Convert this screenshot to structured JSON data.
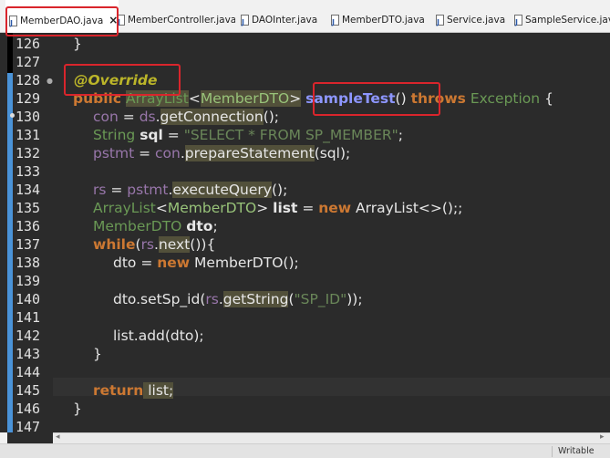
{
  "tabs": [
    {
      "label": "MemberDAO.java",
      "close": "×"
    },
    {
      "label": "MemberController.java"
    },
    {
      "label": "DAOInter.java"
    },
    {
      "label": "MemberDTO.java"
    },
    {
      "label": "Service.java"
    },
    {
      "label": "SampleService.java"
    }
  ],
  "lines": {
    "n126": "126",
    "n127": "127",
    "n128": "128",
    "n129": "129",
    "n130": "130",
    "n131": "131",
    "n132": "132",
    "n133": "133",
    "n134": "134",
    "n135": "135",
    "n136": "136",
    "n137": "137",
    "n138": "138",
    "n139": "139",
    "n140": "140",
    "n141": "141",
    "n142": "142",
    "n143": "143",
    "n144": "144",
    "n145": "145",
    "n146": "146",
    "n147": "147"
  },
  "code": {
    "l126": "}",
    "l128_ann": "@Override",
    "l129_public": "public",
    "l129_type": "ArrayList",
    "l129_lt": "<",
    "l129_gen": "MemberDTO",
    "l129_gt": ">",
    "l129_name": "sampleTest",
    "l129_paren": "()",
    "l129_throws": "throws",
    "l129_exc": "Exception",
    "l129_brace": "{",
    "l130_var": "con",
    "l130_eq": " = ",
    "l130_ds": "ds",
    "l130_dot": ".",
    "l130_call": "getConnection",
    "l130_end": "();",
    "l131_type": "String",
    "l131_name": "sql",
    "l131_eq": " = ",
    "l131_str": "\"SELECT * FROM SP_MEMBER\"",
    "l131_end": ";",
    "l132_var": "pstmt",
    "l132_eq": " = ",
    "l132_con": "con",
    "l132_dot": ".",
    "l132_call": "prepareStatement",
    "l132_end": "(sql);",
    "l134_var": "rs",
    "l134_eq": " = ",
    "l134_pstmt": "pstmt",
    "l134_dot": ".",
    "l134_call": "executeQuery",
    "l134_end": "();",
    "l135_type": "ArrayList",
    "l135_lt": "<",
    "l135_gen": "MemberDTO",
    "l135_gt": ">",
    "l135_name": "list",
    "l135_eq": " = ",
    "l135_new": "new",
    "l135_rest": " ArrayList<>();;",
    "l136_type": "MemberDTO",
    "l136_name": "dto",
    "l136_end": ";",
    "l137_while": "while",
    "l137_open": "(",
    "l137_rs": "rs",
    "l137_dot": ".",
    "l137_call": "next",
    "l137_end": "()){",
    "l138_a": "dto = ",
    "l138_new": "new",
    "l138_rest": " MemberDTO();",
    "l140_a": "dto.setSp_id(",
    "l140_rs": "rs",
    "l140_dot": ".",
    "l140_call": "getString",
    "l140_open": "(",
    "l140_str": "\"SP_ID\"",
    "l140_end": "));",
    "l142": "list.add(dto);",
    "l143": "}",
    "l145_ret": "return",
    "l145_rest": " list;",
    "l146": "}"
  },
  "status": {
    "mode": "Writable"
  },
  "colors": {
    "highlight_box": "#d9252c",
    "ruler": "#4a93d8",
    "keyword": "#cc7832",
    "method_name": "#8d96ff"
  }
}
